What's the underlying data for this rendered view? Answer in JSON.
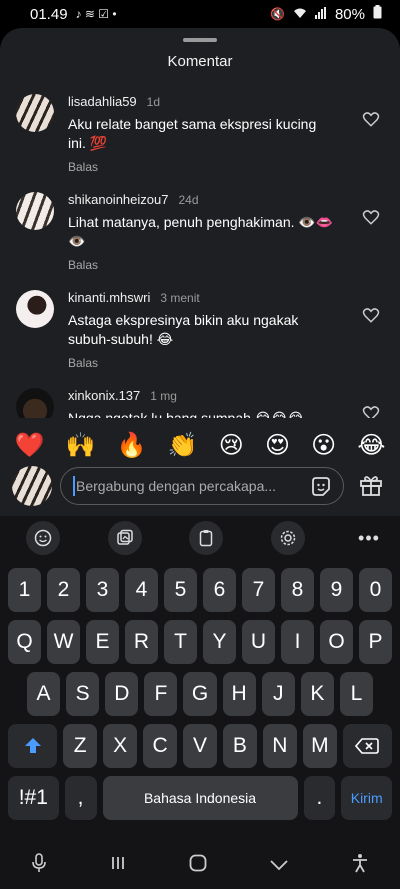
{
  "status": {
    "time": "01.49",
    "battery": "80%"
  },
  "sheet": {
    "title": "Komentar"
  },
  "comments": [
    {
      "user": "lisadahlia59",
      "time": "1d",
      "text": "Aku relate banget sama ekspresi kucing ini. 💯",
      "reply": "Balas"
    },
    {
      "user": "shikanoinheizou7",
      "time": "24d",
      "text": "Lihat matanya, penuh penghakiman. 👁️👄👁️",
      "reply": "Balas"
    },
    {
      "user": "kinanti.mhswri",
      "time": "3 menit",
      "text": "Astaga ekspresinya bikin aku ngakak subuh-subuh! 😂",
      "reply": "Balas"
    },
    {
      "user": "xinkonix.137",
      "time": "1 mg",
      "text": "Ngga ngotak lu bang sumpah 😂😂😂",
      "reply": ""
    }
  ],
  "emojis": [
    "❤️",
    "🙌",
    "🔥",
    "👏",
    "😢",
    "😍",
    "😮",
    "😂"
  ],
  "composer": {
    "placeholder": "Bergabung dengan percakapa..."
  },
  "keyboard": {
    "row1": [
      "1",
      "2",
      "3",
      "4",
      "5",
      "6",
      "7",
      "8",
      "9",
      "0"
    ],
    "row2": [
      "Q",
      "W",
      "E",
      "R",
      "T",
      "Y",
      "U",
      "I",
      "O",
      "P"
    ],
    "row3": [
      "A",
      "S",
      "D",
      "F",
      "G",
      "H",
      "J",
      "K",
      "L"
    ],
    "row4": [
      "Z",
      "X",
      "C",
      "V",
      "B",
      "N",
      "M"
    ],
    "symbols_label": "!#1",
    "comma": ",",
    "space_label": "Bahasa Indonesia",
    "period": ".",
    "enter_label": "Kirim"
  },
  "colors": {
    "accent": "#4a9cff",
    "sheet_bg": "#1e1f22",
    "key_bg": "#3b3c40"
  }
}
